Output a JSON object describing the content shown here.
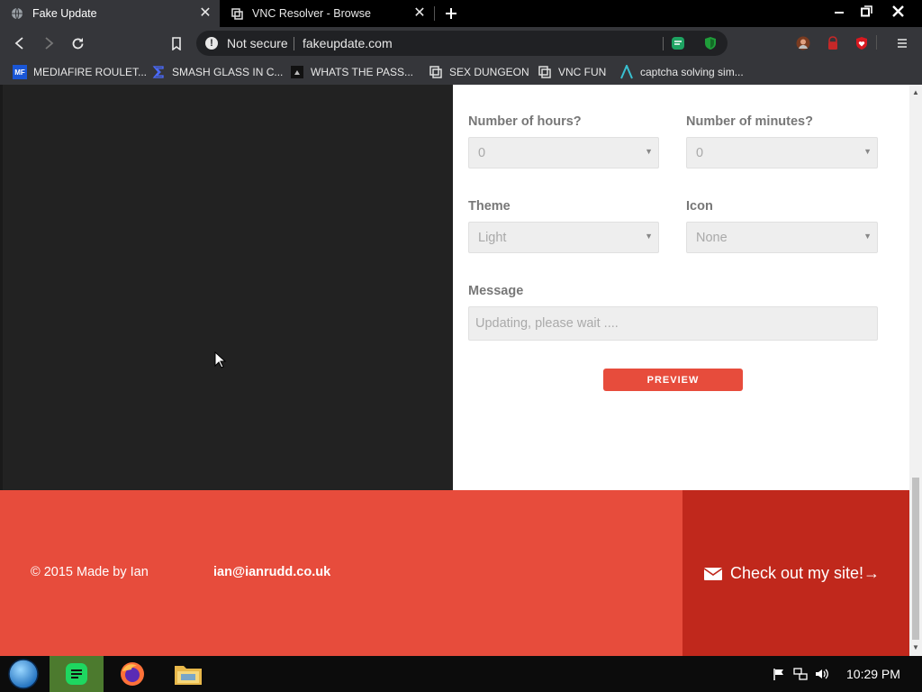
{
  "browser": {
    "tabs": [
      {
        "title": "Fake Update",
        "active": true
      },
      {
        "title": "VNC Resolver - Browse",
        "active": false
      }
    ],
    "address": {
      "security_label": "Not secure",
      "url": "fakeupdate.com"
    },
    "bookmarks": [
      {
        "label": "MEDIAFIRE ROULET..."
      },
      {
        "label": "SMASH GLASS IN C..."
      },
      {
        "label": "WHATS THE PASS..."
      },
      {
        "label": "SEX DUNGEON"
      },
      {
        "label": "VNC FUN"
      },
      {
        "label": "captcha solving sim..."
      }
    ],
    "mediafire_icon_text": "MF"
  },
  "form": {
    "hours_label": "Number of hours?",
    "hours_value": "0",
    "minutes_label": "Number of minutes?",
    "minutes_value": "0",
    "theme_label": "Theme",
    "theme_value": "Light",
    "icon_label": "Icon",
    "icon_value": "None",
    "message_label": "Message",
    "message_placeholder": "Updating, please wait ....",
    "preview_label": "PREVIEW"
  },
  "footer": {
    "copyright": "© 2015 Made by Ian",
    "email": "ian@ianrudd.co.uk",
    "cta": "Check out my site!→"
  },
  "taskbar": {
    "clock": "10:29 PM"
  },
  "colors": {
    "accent_red": "#e74c3c",
    "dark_red": "#c0281c",
    "dark_panel": "#222222",
    "chrome_dark": "#35363a"
  }
}
